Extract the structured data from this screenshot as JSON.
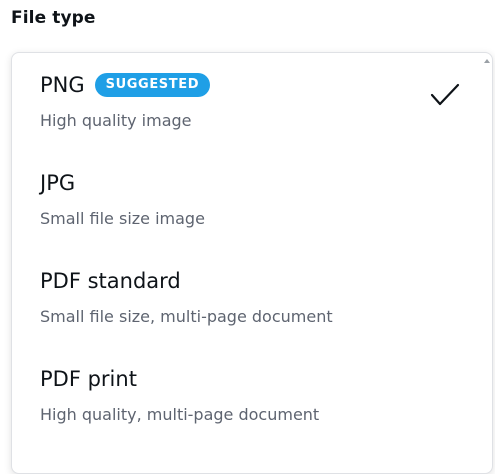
{
  "section": {
    "label": "File type"
  },
  "dropdown": {
    "options": [
      {
        "title": "PNG",
        "badge": "SUGGESTED",
        "subtitle": "High quality image",
        "selected": true
      },
      {
        "title": "JPG",
        "subtitle": "Small file size image",
        "selected": false
      },
      {
        "title": "PDF standard",
        "subtitle": "Small file size, multi-page document",
        "selected": false
      },
      {
        "title": "PDF print",
        "subtitle": "High quality, multi-page document",
        "selected": false
      }
    ],
    "selected_icon": "checkmark-icon"
  },
  "colors": {
    "badge_background": "#1f9fe6",
    "badge_text": "#ffffff",
    "title_text": "#0e1318",
    "subtitle_text": "#5e6470"
  }
}
